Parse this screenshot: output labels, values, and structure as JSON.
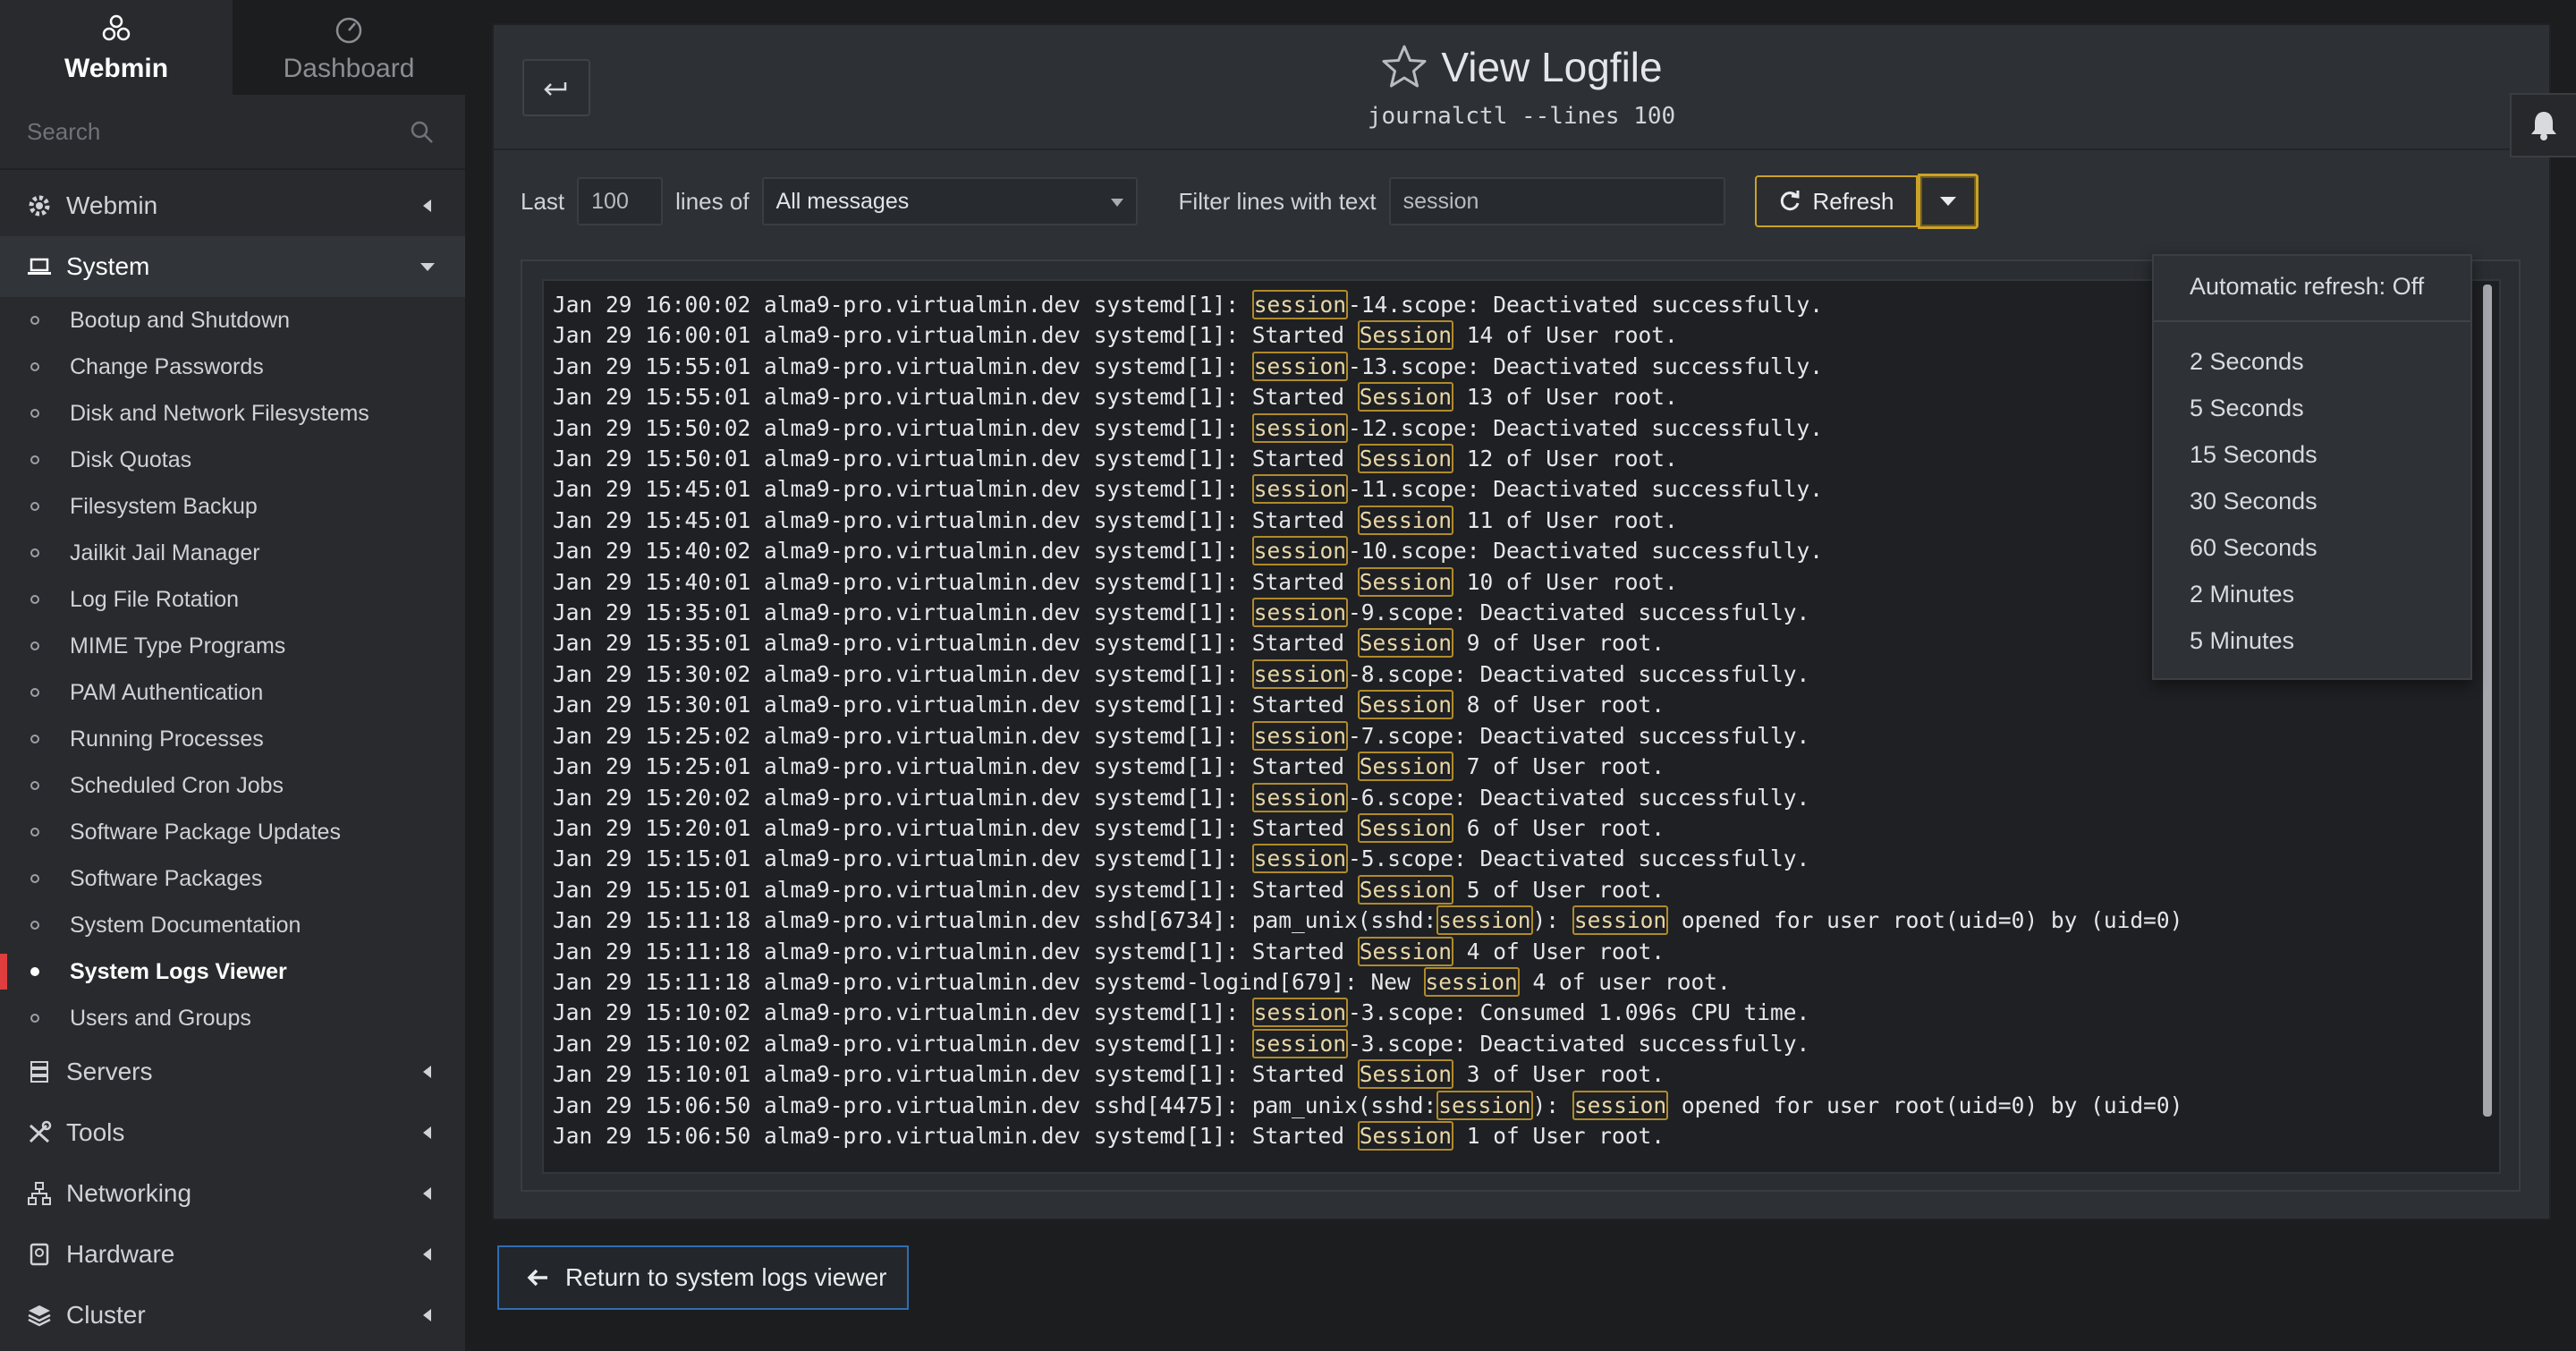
{
  "sidebar": {
    "tabs": [
      {
        "label": "Webmin",
        "icon": "webmin-logo-icon",
        "active": true
      },
      {
        "label": "Dashboard",
        "icon": "dashboard-gauge-icon",
        "active": false
      }
    ],
    "search_placeholder": "Search",
    "categories": {
      "webmin": "Webmin",
      "system": "System",
      "servers": "Servers",
      "tools": "Tools",
      "networking": "Networking",
      "hardware": "Hardware",
      "cluster": "Cluster"
    },
    "system_items": [
      "Bootup and Shutdown",
      "Change Passwords",
      "Disk and Network Filesystems",
      "Disk Quotas",
      "Filesystem Backup",
      "Jailkit Jail Manager",
      "Log File Rotation",
      "MIME Type Programs",
      "PAM Authentication",
      "Running Processes",
      "Scheduled Cron Jobs",
      "Software Package Updates",
      "Software Packages",
      "System Documentation",
      "System Logs Viewer",
      "Users and Groups"
    ],
    "active_item": "System Logs Viewer"
  },
  "header": {
    "title": "View Logfile",
    "subtitle": "journalctl --lines 100"
  },
  "controls": {
    "last_label": "Last",
    "lines_value": "100",
    "lines_of_label": "lines of",
    "source_selected": "All messages",
    "filter_label": "Filter lines with text",
    "filter_value": "session",
    "refresh_label": "Refresh"
  },
  "refresh_menu": {
    "status": "Automatic refresh: Off",
    "options": [
      "2 Seconds",
      "5 Seconds",
      "15 Seconds",
      "30 Seconds",
      "60 Seconds",
      "2 Minutes",
      "5 Minutes"
    ]
  },
  "log": {
    "highlight_term": "session",
    "lines": [
      "Jan 29 16:00:02 alma9-pro.virtualmin.dev systemd[1]: session-14.scope: Deactivated successfully.",
      "Jan 29 16:00:01 alma9-pro.virtualmin.dev systemd[1]: Started Session 14 of User root.",
      "Jan 29 15:55:01 alma9-pro.virtualmin.dev systemd[1]: session-13.scope: Deactivated successfully.",
      "Jan 29 15:55:01 alma9-pro.virtualmin.dev systemd[1]: Started Session 13 of User root.",
      "Jan 29 15:50:02 alma9-pro.virtualmin.dev systemd[1]: session-12.scope: Deactivated successfully.",
      "Jan 29 15:50:01 alma9-pro.virtualmin.dev systemd[1]: Started Session 12 of User root.",
      "Jan 29 15:45:01 alma9-pro.virtualmin.dev systemd[1]: session-11.scope: Deactivated successfully.",
      "Jan 29 15:45:01 alma9-pro.virtualmin.dev systemd[1]: Started Session 11 of User root.",
      "Jan 29 15:40:02 alma9-pro.virtualmin.dev systemd[1]: session-10.scope: Deactivated successfully.",
      "Jan 29 15:40:01 alma9-pro.virtualmin.dev systemd[1]: Started Session 10 of User root.",
      "Jan 29 15:35:01 alma9-pro.virtualmin.dev systemd[1]: session-9.scope: Deactivated successfully.",
      "Jan 29 15:35:01 alma9-pro.virtualmin.dev systemd[1]: Started Session 9 of User root.",
      "Jan 29 15:30:02 alma9-pro.virtualmin.dev systemd[1]: session-8.scope: Deactivated successfully.",
      "Jan 29 15:30:01 alma9-pro.virtualmin.dev systemd[1]: Started Session 8 of User root.",
      "Jan 29 15:25:02 alma9-pro.virtualmin.dev systemd[1]: session-7.scope: Deactivated successfully.",
      "Jan 29 15:25:01 alma9-pro.virtualmin.dev systemd[1]: Started Session 7 of User root.",
      "Jan 29 15:20:02 alma9-pro.virtualmin.dev systemd[1]: session-6.scope: Deactivated successfully.",
      "Jan 29 15:20:01 alma9-pro.virtualmin.dev systemd[1]: Started Session 6 of User root.",
      "Jan 29 15:15:01 alma9-pro.virtualmin.dev systemd[1]: session-5.scope: Deactivated successfully.",
      "Jan 29 15:15:01 alma9-pro.virtualmin.dev systemd[1]: Started Session 5 of User root.",
      "Jan 29 15:11:18 alma9-pro.virtualmin.dev sshd[6734]: pam_unix(sshd:session): session opened for user root(uid=0) by (uid=0)",
      "Jan 29 15:11:18 alma9-pro.virtualmin.dev systemd[1]: Started Session 4 of User root.",
      "Jan 29 15:11:18 alma9-pro.virtualmin.dev systemd-logind[679]: New session 4 of user root.",
      "Jan 29 15:10:02 alma9-pro.virtualmin.dev systemd[1]: session-3.scope: Consumed 1.096s CPU time.",
      "Jan 29 15:10:02 alma9-pro.virtualmin.dev systemd[1]: session-3.scope: Deactivated successfully.",
      "Jan 29 15:10:01 alma9-pro.virtualmin.dev systemd[1]: Started Session 3 of User root.",
      "Jan 29 15:06:50 alma9-pro.virtualmin.dev sshd[4475]: pam_unix(sshd:session): session opened for user root(uid=0) by (uid=0)",
      "Jan 29 15:06:50 alma9-pro.virtualmin.dev systemd[1]: Started Session 1 of User root."
    ]
  },
  "footer": {
    "return_label": "Return to system logs viewer"
  },
  "colors": {
    "accent_active": "#e03e3e",
    "highlight_border": "#b08a2a",
    "refresh_border": "#c9a227",
    "return_border": "#2f6db3"
  }
}
